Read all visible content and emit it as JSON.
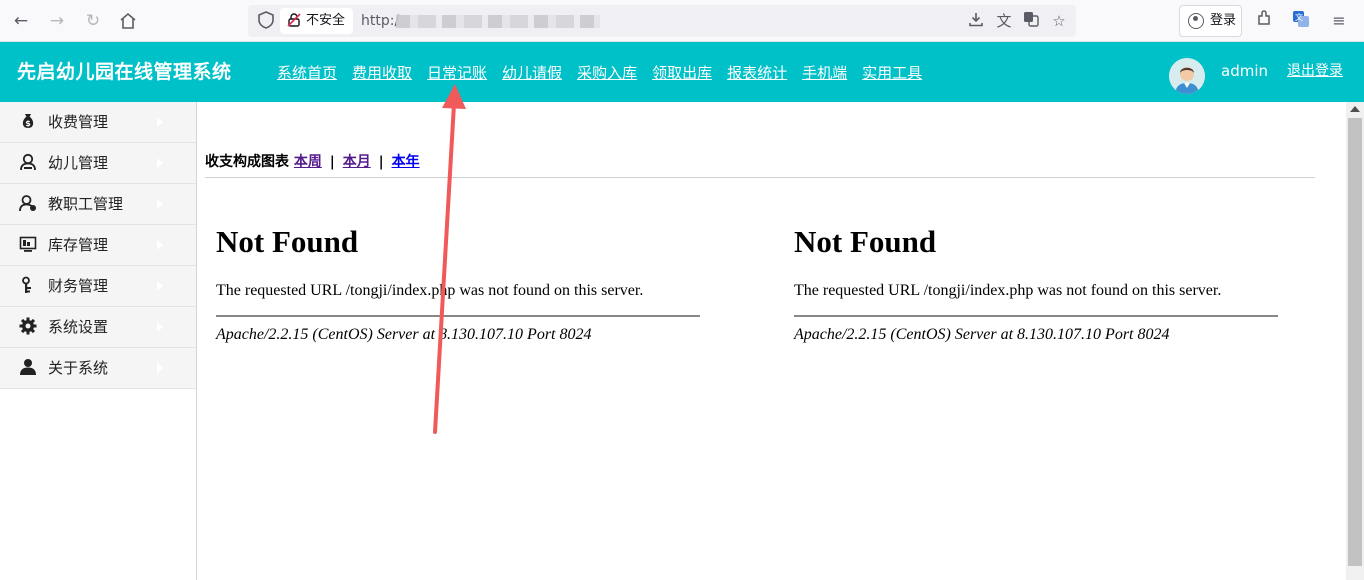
{
  "browser": {
    "insecure_label": "不安全",
    "url_prefix": "http:/",
    "login_label": "登录"
  },
  "app": {
    "title": "先启幼儿园在线管理系统",
    "nav": [
      {
        "label": "系统首页"
      },
      {
        "label": "费用收取"
      },
      {
        "label": "日常记账"
      },
      {
        "label": "幼儿请假"
      },
      {
        "label": "采购入库"
      },
      {
        "label": "领取出库"
      },
      {
        "label": "报表统计"
      },
      {
        "label": "手机端"
      },
      {
        "label": "实用工具"
      }
    ],
    "username": "admin",
    "logout_label": "退出登录"
  },
  "sidebar": {
    "items": [
      {
        "label": "收费管理",
        "icon": "money-bag-icon"
      },
      {
        "label": "幼儿管理",
        "icon": "child-icon"
      },
      {
        "label": "教职工管理",
        "icon": "staff-icon"
      },
      {
        "label": "库存管理",
        "icon": "inventory-icon"
      },
      {
        "label": "财务管理",
        "icon": "finance-icon"
      },
      {
        "label": "系统设置",
        "icon": "gear-icon"
      },
      {
        "label": "关于系统",
        "icon": "user-icon"
      }
    ]
  },
  "content": {
    "chart_title": "收支构成图表",
    "periods": [
      "本周",
      "本月",
      "本年"
    ],
    "separator": "|",
    "panels": [
      {
        "heading": "Not Found",
        "message": "The requested URL /tongji/index.php was not found on this server.",
        "server": "Apache/2.2.15 (CentOS) Server at 8.130.107.10 Port 8024"
      },
      {
        "heading": "Not Found",
        "message": "The requested URL /tongji/index.php was not found on this server.",
        "server": "Apache/2.2.15 (CentOS) Server at 8.130.107.10 Port 8024"
      }
    ]
  },
  "colors": {
    "header_bg": "#00c0c8",
    "annotation_arrow": "#f05a5a",
    "link": "#0000ee",
    "visited_link": "#551a8b"
  }
}
